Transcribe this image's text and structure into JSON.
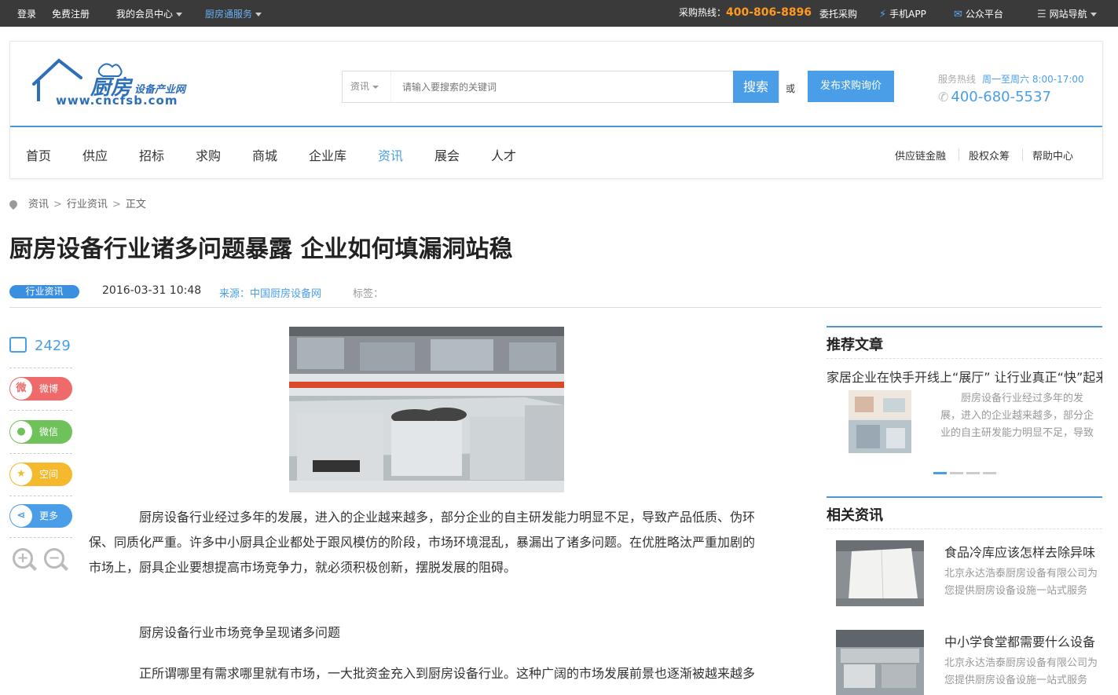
{
  "topbar": {
    "login": "登录",
    "register": "免费注册",
    "member_center": "我的会员中心",
    "kitchen_service": "厨房通服务",
    "hotline_label": "采购热线：",
    "hotline_number": "400-806-8896",
    "entrust": "委托采购",
    "mobile_app": "手机APP",
    "public_platform": "公众平台",
    "site_nav": "网站导航"
  },
  "header": {
    "logo_main": "厨房",
    "logo_sub": "设备产业网",
    "logo_url": "www.cncfsb.com",
    "search_category": "资讯",
    "search_placeholder": "请输入要搜索的关键词",
    "search_button": "搜索",
    "or_text": "或",
    "publish_button": "发布求购询价",
    "service_label": "服务热线",
    "service_hours": "周一至周六 8:00-17:00",
    "service_phone": "400-680-5537"
  },
  "nav": {
    "items": [
      "首页",
      "供应",
      "招标",
      "求购",
      "商城",
      "企业库",
      "资讯",
      "展会",
      "人才"
    ],
    "right": [
      "供应链金融",
      "股权众筹",
      "帮助中心"
    ]
  },
  "breadcrumb": [
    "资讯",
    "行业资讯",
    "正文"
  ],
  "article": {
    "title": "厨房设备行业诸多问题暴露 企业如何填漏洞站稳",
    "tag": "行业资讯",
    "date": "2016-03-31 10:48",
    "source": "来源：中国厨房设备网",
    "tags_label": "标签：",
    "views": "2429",
    "paragraphs": [
      "厨房设备行业经过多年的发展，进入的企业越来越多，部分企业的自主研发能力明显不足，导致产品低质、伪环保、同质化严重。许多中小厨具企业都处于跟风模仿的阶段，市场环境混乱，暴漏出了诸多问题。在优胜略汰严重加剧的市场上，厨具企业要想提高市场竞争力，就必须积极创新，摆脱发展的阻碍。",
      "厨房设备行业市场竞争呈现诸多问题",
      "正所谓哪里有需求哪里就有市场，一大批资金充入到厨房设备行业。这种广阔的市场发展前景也逐渐被越来越多"
    ]
  },
  "share": {
    "weibo": "微博",
    "wechat": "微信",
    "qzone": "空间",
    "more": "更多",
    "colors": {
      "weibo": "#ef6a6a",
      "wechat": "#6fc25a",
      "qzone": "#f4b92c",
      "more": "#4a9ee8"
    }
  },
  "sidebar": {
    "recommended_heading": "推荐文章",
    "recommended_title": "家居企业在快手开线上“展厅” 让行业真正“快”起来",
    "recommended_desc": "厨房设备行业经过多年的发展，进入的企业越来越多，部分企业的自主研发能力明显不足，导致产品低质、伪环保、同质化严重",
    "related_heading": "相关资讯",
    "related": [
      {
        "title": "食品冷库应该怎样去除异味",
        "desc": "北京永达浩泰厨房设备有限公司为您提供厨房设备设施一站式服务"
      },
      {
        "title": "中小学食堂都需要什么设备",
        "desc": "北京永达浩泰厨房设备有限公司为您提供厨房设备设施一站式服务"
      }
    ]
  },
  "colors": {
    "accent": "#4a9ee8",
    "topbar_bg": "#3a3a3a",
    "hotline": "#ff9a1f"
  }
}
